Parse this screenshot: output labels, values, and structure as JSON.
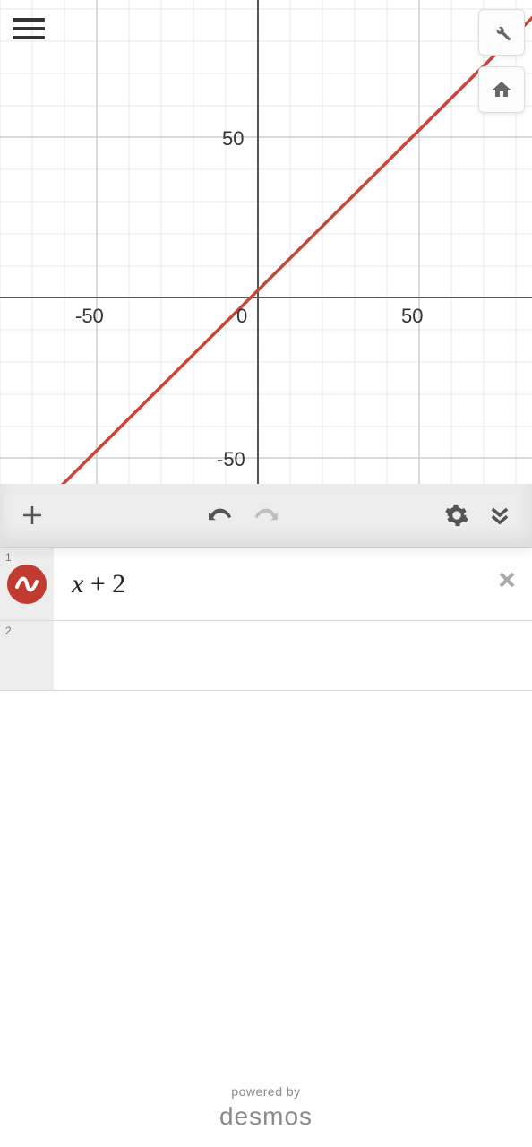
{
  "graph": {
    "axis_labels": {
      "x_neg": "-50",
      "x_zero": "0",
      "x_pos": "50",
      "y_pos": "50",
      "y_neg": "-50"
    }
  },
  "chart_data": {
    "type": "line",
    "title": "",
    "xlabel": "",
    "ylabel": "",
    "xlim": [
      -80,
      85
    ],
    "ylim": [
      -60,
      95
    ],
    "x_ticks": [
      -50,
      0,
      50
    ],
    "y_ticks": [
      -50,
      0,
      50
    ],
    "minor_grid_step": 10,
    "series": [
      {
        "name": "x + 2",
        "expression": "y = x + 2",
        "color": "#c13b31",
        "x": [
          -80,
          85
        ],
        "y": [
          -78,
          87
        ]
      }
    ]
  },
  "toolbar": {
    "add_label": "Add expression",
    "undo_label": "Undo",
    "redo_label": "Redo",
    "settings_label": "Settings",
    "collapse_label": "Collapse"
  },
  "expressions": [
    {
      "index": "1",
      "latex_display": "x + 2",
      "color": "#c13b31"
    },
    {
      "index": "2",
      "latex_display": ""
    }
  ],
  "buttons": {
    "wrench_label": "Graph settings",
    "home_label": "Default viewport",
    "menu_label": "Menu"
  },
  "footer": {
    "powered_by": "powered by",
    "brand": "desmos"
  },
  "colors": {
    "line": "#c13b31",
    "axis": "#222",
    "grid_minor": "#e5e5e5",
    "grid_major": "#cfcfcf"
  }
}
